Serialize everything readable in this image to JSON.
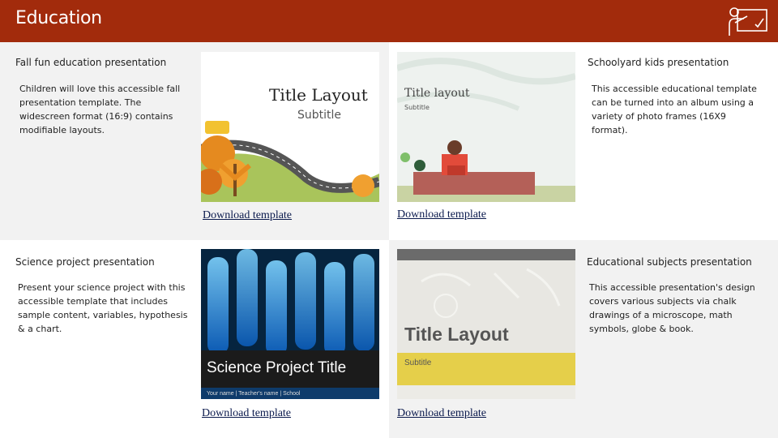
{
  "header": {
    "title": "Education",
    "icon": "teacher-board-icon",
    "color": "#A22B0C"
  },
  "templates": [
    {
      "title": "Fall fun education presentation",
      "description": "Children will love this accessible fall presentation template. The widescreen format (16:9) contains modifiable layouts.",
      "download_label": "Download template",
      "thumbnail": {
        "title": "Title Layout",
        "subtitle": "Subtitle"
      }
    },
    {
      "title": "Schoolyard kids presentation",
      "description": "This accessible educational template can be turned into an album using a variety of photo frames (16X9 format).",
      "download_label": "Download template",
      "thumbnail": {
        "title": "Title layout",
        "subtitle": "Subtitle"
      }
    },
    {
      "title": "Science project presentation",
      "description": "Present your science project with this accessible template that includes sample content, variables, hypothesis & a chart.",
      "download_label": "Download template",
      "thumbnail": {
        "title": "Science Project Title",
        "subtitle": "Your name | Teacher's name | School"
      }
    },
    {
      "title": "Educational subjects presentation",
      "description": "This accessible presentation's design covers various subjects via chalk drawings of a microscope, math symbols, globe & book.",
      "download_label": "Download template",
      "thumbnail": {
        "title": "Title Layout",
        "subtitle": "Subtitle"
      }
    }
  ]
}
